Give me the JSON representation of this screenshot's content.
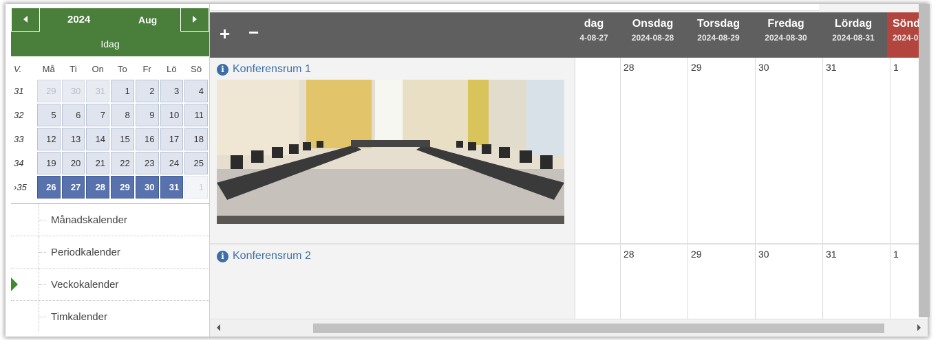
{
  "mini_calendar": {
    "prev_icon": "caret-left-icon",
    "next_icon": "caret-right-icon",
    "year": "2024",
    "month": "Aug",
    "today_label": "Idag",
    "week_header": "V.",
    "weekdays": [
      "Må",
      "Ti",
      "On",
      "To",
      "Fr",
      "Lö",
      "Sö"
    ],
    "weeks": [
      {
        "week": "31",
        "days": [
          "29",
          "30",
          "31",
          "1",
          "2",
          "3",
          "4"
        ]
      },
      {
        "week": "32",
        "days": [
          "5",
          "6",
          "7",
          "8",
          "9",
          "10",
          "11"
        ]
      },
      {
        "week": "33",
        "days": [
          "12",
          "13",
          "14",
          "15",
          "16",
          "17",
          "18"
        ]
      },
      {
        "week": "34",
        "days": [
          "19",
          "20",
          "21",
          "22",
          "23",
          "24",
          "25"
        ]
      },
      {
        "week": "35",
        "days": [
          "26",
          "27",
          "28",
          "29",
          "30",
          "31",
          "1"
        ]
      }
    ]
  },
  "menu": {
    "items": [
      {
        "label": "Månadskalender"
      },
      {
        "label": "Periodkalender"
      },
      {
        "label": "Veckokalender"
      },
      {
        "label": "Timkalender"
      }
    ],
    "active_icon": "triangle-right-icon"
  },
  "toolbar": {
    "plus_label": "+",
    "minus_label": "−"
  },
  "days": [
    {
      "name": "dag",
      "date": "4-08-27"
    },
    {
      "name": "Onsdag",
      "date": "2024-08-28"
    },
    {
      "name": "Torsdag",
      "date": "2024-08-29"
    },
    {
      "name": "Fredag",
      "date": "2024-08-30"
    },
    {
      "name": "Lördag",
      "date": "2024-08-31"
    },
    {
      "name": "Sönd",
      "date": "2024-0"
    }
  ],
  "rooms": [
    {
      "name": "Konferensrum 1",
      "info_icon": "info-icon",
      "cells": [
        "",
        "28",
        "29",
        "30",
        "31",
        "1"
      ]
    },
    {
      "name": "Konferensrum 2",
      "info_icon": "info-icon",
      "cells": [
        "",
        "28",
        "29",
        "30",
        "31",
        "1"
      ]
    }
  ],
  "colors": {
    "green": "#4a7f3b",
    "selected_week": "#5872ad",
    "header_gray": "#5f5f5f",
    "sunday_red": "#b2453d",
    "link_blue": "#3d6ea8"
  }
}
